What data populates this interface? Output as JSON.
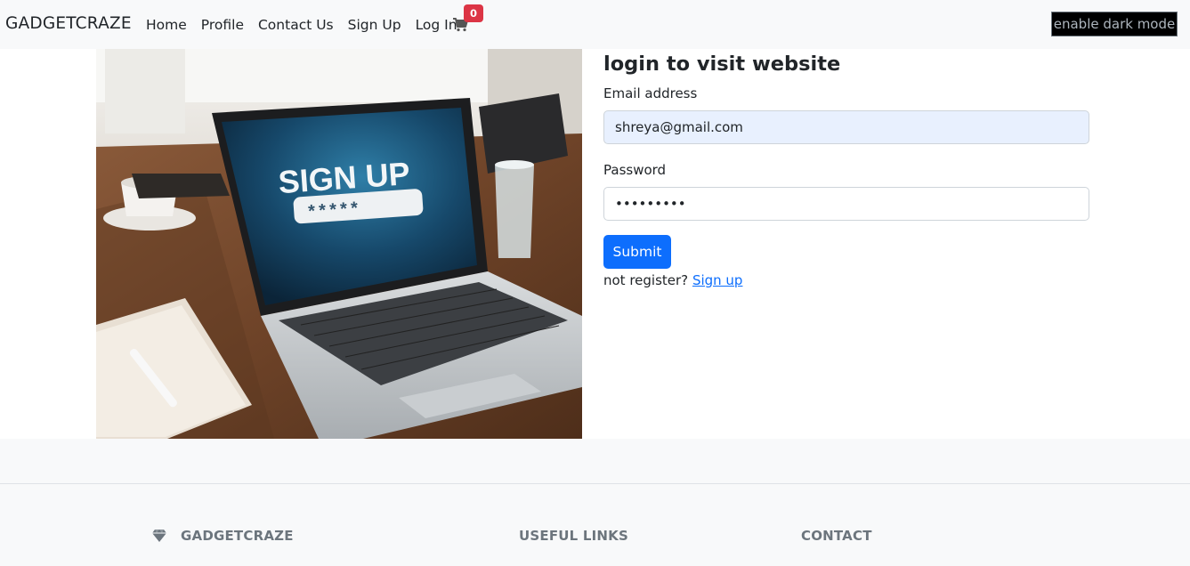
{
  "navbar": {
    "brand": "GADGETCRAZE",
    "links": [
      "Home",
      "Profile",
      "Contact Us",
      "Sign Up",
      "Log In"
    ],
    "cart_icon": "shopping-cart-icon",
    "cart_count": "0",
    "dark_mode_label": "enable dark mode"
  },
  "hero": {
    "image_text": "SIGN UP",
    "image_password": "*****"
  },
  "login": {
    "title": "login to visit website",
    "email_label": "Email address",
    "email_value": "shreya@gmail.com",
    "password_label": "Password",
    "password_value": "shreya123",
    "submit_label": "Submit",
    "register_text": "not register?",
    "register_link": "Sign up"
  },
  "footer": {
    "brand": "GADGETCRAZE",
    "brand_icon": "gem-icon",
    "useful_links": "USEFUL LINKS",
    "contact": "CONTACT"
  },
  "colors": {
    "primary": "#0d6efd",
    "danger": "#dc3545",
    "light_bg": "#f8f9fa",
    "autofill_bg": "#e8f0fe"
  }
}
